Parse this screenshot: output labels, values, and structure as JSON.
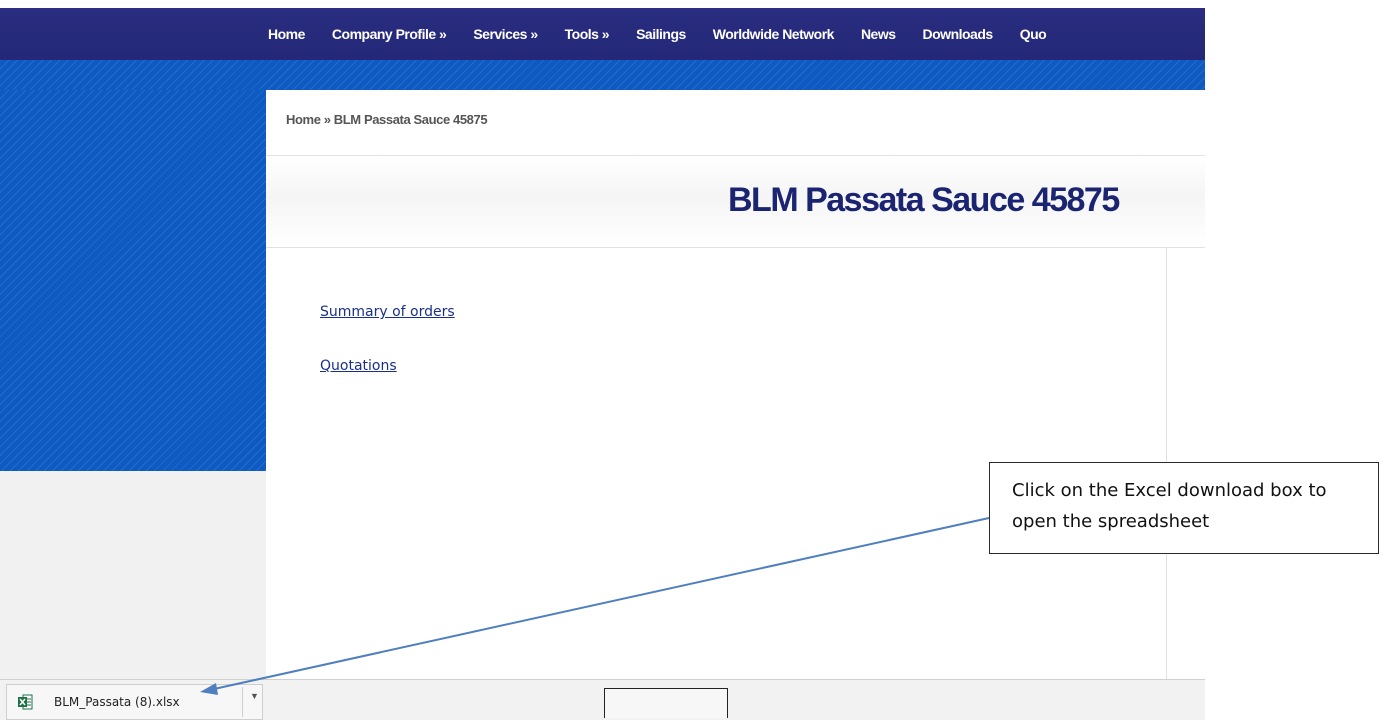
{
  "nav": {
    "items": [
      "Home",
      "Company Profile »",
      "Services »",
      "Tools »",
      "Sailings",
      "Worldwide Network",
      "News",
      "Downloads",
      "Quo"
    ]
  },
  "breadcrumb": {
    "text": "Home » BLM Passata Sauce 45875"
  },
  "page": {
    "title": "BLM Passata Sauce 45875",
    "links": {
      "summary": "Summary of orders",
      "quotations": "Quotations"
    }
  },
  "download_bar": {
    "file_name": "BLM_Passata (8).xlsx",
    "file_icon": "excel-icon",
    "dropdown_icon": "chevron-down-icon"
  },
  "callout": {
    "text": "Click on the Excel download box to open the spreadsheet"
  },
  "colors": {
    "nav_bg": "#2a2d80",
    "side_blue": "#0d5ac2",
    "title_color": "#1b2470",
    "link_color": "#1a2f8a",
    "arrow_color": "#4f7fbf",
    "excel_green": "#1e7145"
  }
}
